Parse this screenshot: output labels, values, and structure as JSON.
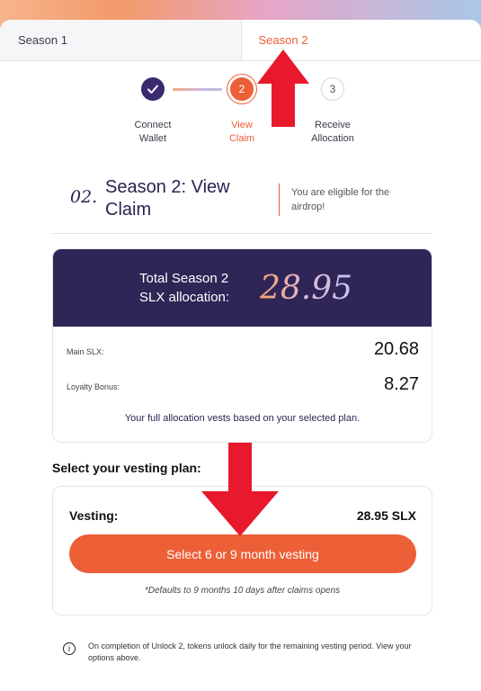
{
  "tabs": [
    {
      "label": "Season 1"
    },
    {
      "label": "Season 2"
    }
  ],
  "steps": [
    {
      "number": "",
      "label_line1": "Connect",
      "label_line2": "Wallet"
    },
    {
      "number": "2",
      "label_line1": "View",
      "label_line2": "Claim"
    },
    {
      "number": "3",
      "label_line1": "Receive",
      "label_line2": "Allocation"
    }
  ],
  "header": {
    "number": "02.",
    "title": "Season 2: View Claim",
    "note": "You are eligible for the airdrop!"
  },
  "allocation": {
    "label_line1": "Total Season 2",
    "label_line2": "SLX allocation:",
    "total": "28.95",
    "rows": [
      {
        "label": "Main SLX:",
        "value": "20.68"
      },
      {
        "label": "Loyalty Bonus:",
        "value": "8.27"
      }
    ],
    "note": "Your full allocation vests based on your selected plan."
  },
  "plan": {
    "heading": "Select your vesting plan:",
    "vesting_label": "Vesting:",
    "vesting_value": "28.95 SLX",
    "button_label": "Select 6 or 9 month vesting",
    "note": "*Defaults to 9 months 10 days after claims opens"
  },
  "info": {
    "text": "On completion of Unlock 2, tokens unlock daily for the remaining vesting period. View your options above."
  },
  "colors": {
    "accent": "#ec5f37",
    "primary": "#2f2557",
    "arrow": "#e8192c"
  }
}
